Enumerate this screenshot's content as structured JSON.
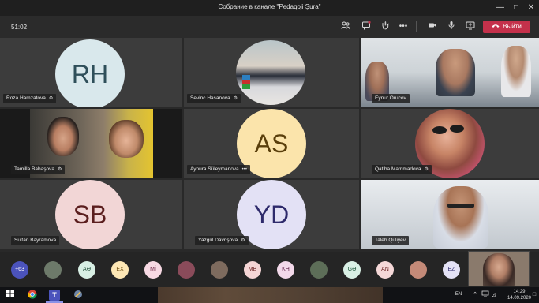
{
  "window": {
    "title": "Собрание в канале \"Pedaqoji Şura\""
  },
  "toolbar": {
    "timer": "51:02",
    "leave_label": "Выйти"
  },
  "tiles": [
    {
      "name": "Roza Hamzatova",
      "initials": "RH",
      "avatar_bg": "#d9e8ec",
      "avatar_fg": "#2f4f5a"
    },
    {
      "name": "Sevinc Hasanova",
      "initials": "",
      "avatar_bg": "",
      "avatar_fg": ""
    },
    {
      "name": "Eynur Orucov",
      "initials": "",
      "avatar_bg": "",
      "avatar_fg": ""
    },
    {
      "name": "Tamilla Babaşova",
      "initials": "",
      "avatar_bg": "",
      "avatar_fg": ""
    },
    {
      "name": "Aynura Süleymanova",
      "initials": "AS",
      "avatar_bg": "#fbe4ab",
      "avatar_fg": "#5a3f0c"
    },
    {
      "name": "Qatiba Mammadova",
      "initials": "",
      "avatar_bg": "",
      "avatar_fg": ""
    },
    {
      "name": "Sultan Bayramova",
      "initials": "SB",
      "avatar_bg": "#f2d6d6",
      "avatar_fg": "#5b1e1e"
    },
    {
      "name": "Yazgül Davrişova",
      "initials": "YD",
      "avatar_bg": "#e3e1f5",
      "avatar_fg": "#2e2a6b"
    },
    {
      "name": "Taleh Quliyev",
      "initials": "",
      "avatar_bg": "",
      "avatar_fg": ""
    }
  ],
  "strip": {
    "overflow_count": "+63",
    "chips": [
      {
        "label": "",
        "kind": "photo",
        "bg": "#6d7a6a",
        "fg": "#fff"
      },
      {
        "label": "AƏ",
        "kind": "initials",
        "bg": "#d8efe4",
        "fg": "#23513b"
      },
      {
        "label": "EX",
        "kind": "initials",
        "bg": "#fde7b5",
        "fg": "#6b4a0d"
      },
      {
        "label": "Mİ",
        "kind": "initials",
        "bg": "#f7d9e3",
        "fg": "#6b2040"
      },
      {
        "label": "",
        "kind": "photo",
        "bg": "#8a4b5a",
        "fg": "#fff"
      },
      {
        "label": "",
        "kind": "photo",
        "bg": "#7e6b5e",
        "fg": "#fff"
      },
      {
        "label": "MB",
        "kind": "initials",
        "bg": "#f5d5d5",
        "fg": "#6b2020"
      },
      {
        "label": "KH",
        "kind": "initials",
        "bg": "#f3d9ea",
        "fg": "#5f1f47"
      },
      {
        "label": "",
        "kind": "photo",
        "bg": "#5d6e58",
        "fg": "#fff"
      },
      {
        "label": "GƏ",
        "kind": "initials",
        "bg": "#d9f0e5",
        "fg": "#225a3f"
      },
      {
        "label": "AN",
        "kind": "initials",
        "bg": "#f5d8d8",
        "fg": "#6b2222"
      },
      {
        "label": "",
        "kind": "photo",
        "bg": "#c48a78",
        "fg": "#fff"
      },
      {
        "label": "EZ",
        "kind": "initials",
        "bg": "#e4e2f6",
        "fg": "#2f2b6e"
      }
    ]
  },
  "taskbar": {
    "lang": "EN",
    "time": "14:29",
    "date": "14.09.2020"
  }
}
